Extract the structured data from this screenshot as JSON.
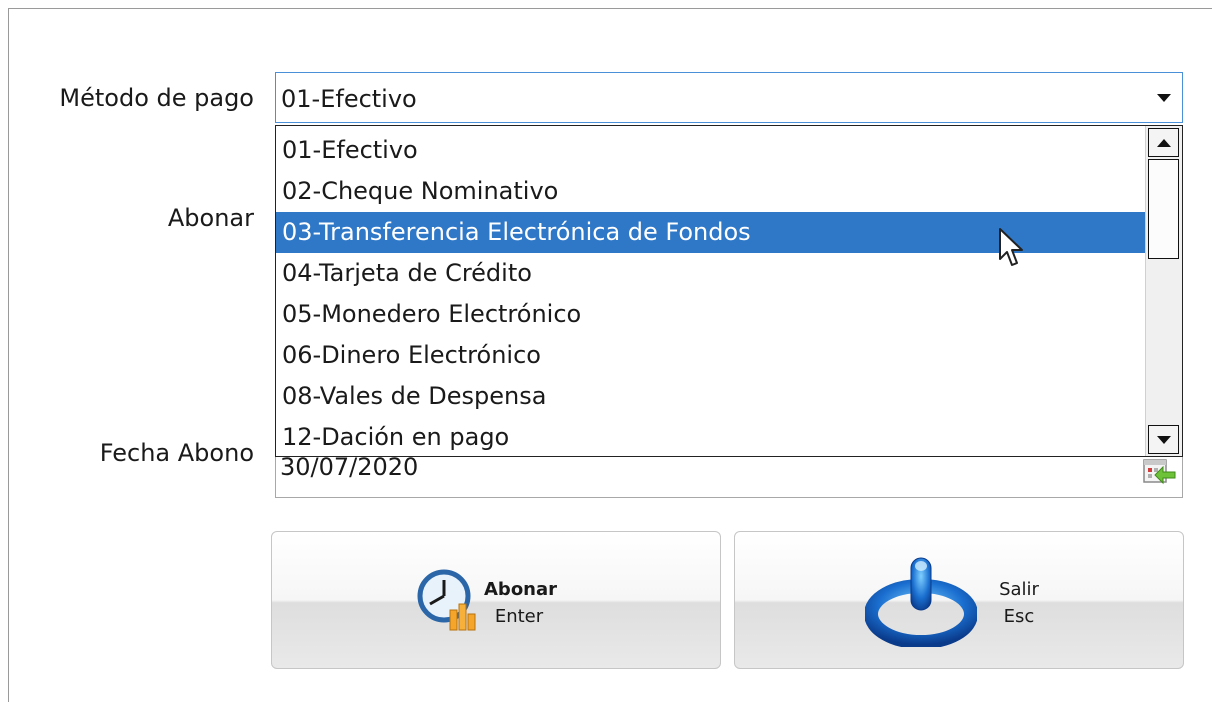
{
  "form": {
    "metodo_label": "Método de pago",
    "abonar_label": "Abonar",
    "fecha_label": "Fecha Abono",
    "metodo_value": "01-Efectivo",
    "fecha_value": "30/07/2020"
  },
  "dropdown": {
    "items": [
      "01-Efectivo",
      "02-Cheque Nominativo",
      "03-Transferencia Electrónica de Fondos",
      "04-Tarjeta de Crédito",
      "05-Monedero Electrónico",
      "06-Dinero Electrónico",
      "08-Vales de Despensa",
      "12-Dación en pago"
    ],
    "selected": "03-Transferencia Electrónica de Fondos"
  },
  "buttons": {
    "abonar": {
      "label": "Abonar",
      "shortcut": "Enter"
    },
    "salir": {
      "label": "Salir",
      "shortcut": "Esc"
    }
  },
  "colors": {
    "selection": "#2f78c8",
    "focus_border": "#4a90d9"
  },
  "icons": {
    "abonar": "clock-coins-icon",
    "salir": "power-icon",
    "date": "calendar-arrow-icon"
  }
}
